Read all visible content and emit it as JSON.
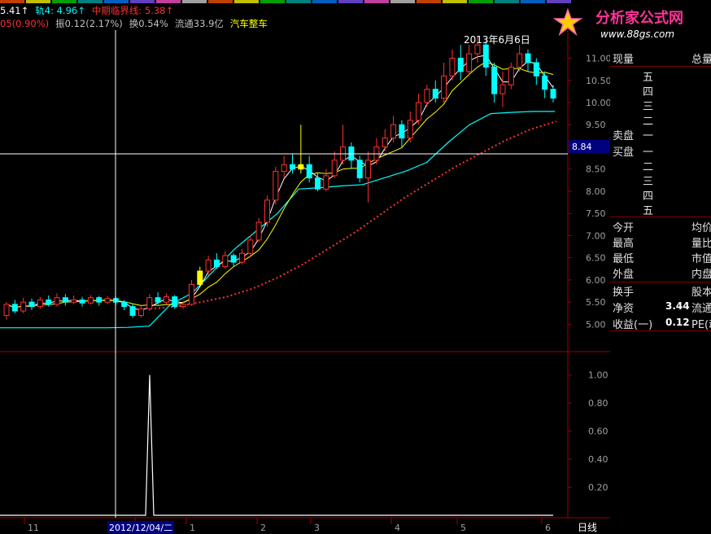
{
  "legend": {
    "line1": [
      {
        "text": "5.41↑",
        "color": "#ffffff"
      },
      {
        "text": "轨4: 4.96↑",
        "color": "#00ffff"
      },
      {
        "text": "中期临界线: 5.38↑",
        "color": "#ff3030"
      }
    ],
    "line2": [
      {
        "text": "05(0.90%)",
        "color": "#ff3030"
      },
      {
        "text": "振0.12(2.17%)",
        "color": "#c0c0c0"
      },
      {
        "text": "换0.54%",
        "color": "#c0c0c0"
      },
      {
        "text": "流通33.9亿",
        "color": "#c0c0c0"
      },
      {
        "text": "汽车整车",
        "color": "#ffff00"
      }
    ]
  },
  "logo": {
    "title": "分析家公式网",
    "url": "www.88gs.com"
  },
  "main_panel": {
    "annotation": "2013年6月6日",
    "crosshair_price": "8.84",
    "y_ticks": [
      "11.00",
      "10.50",
      "10.00",
      "9.50",
      "9.00",
      "8.50",
      "8.00",
      "7.50",
      "7.00",
      "6.50",
      "6.00",
      "5.50",
      "5.00"
    ]
  },
  "sub_panel": {
    "y_ticks": [
      "1.00",
      "0.80",
      "0.60",
      "0.40",
      "0.20"
    ]
  },
  "x_axis": {
    "labels": [
      "11",
      "2012/12/04/二",
      "1",
      "2",
      "3",
      "4",
      "5",
      "6"
    ],
    "period": "日线"
  },
  "side_panel": {
    "header": {
      "left": "现量",
      "right": "总量"
    },
    "asks": [
      "五",
      "四",
      "三",
      "二",
      "一"
    ],
    "sell_label": "卖盘",
    "buy_label": "买盘",
    "bids": [
      "一",
      "二",
      "三",
      "四",
      "五"
    ],
    "stats_left": [
      "今开",
      "最高",
      "最低",
      "外盘"
    ],
    "stats_right": [
      "均价",
      "量比",
      "市值",
      "内盘"
    ],
    "turnover_label": "换手",
    "turnover_right": "股本",
    "nav_label": "净资",
    "nav_value": "3.44",
    "nav_right": "流通",
    "eps_label": "收益(一)",
    "eps_value": "0.12",
    "eps_right": "PE(动"
  },
  "chart_data": {
    "type": "candlestick",
    "ylim": [
      4.75,
      11.45
    ],
    "series": [
      {
        "name": "轨4",
        "color": "#00ffff",
        "values": [
          4.92,
          4.92,
          4.92,
          4.92,
          4.92,
          4.92,
          4.93,
          4.96,
          5.45,
          5.7,
          6.2,
          6.7,
          7.1,
          7.5,
          8.05,
          8.08,
          8.12,
          8.15,
          8.3,
          8.45,
          8.65,
          9.1,
          9.5,
          9.75,
          9.78,
          9.8,
          9.8
        ]
      },
      {
        "name": "中期临界线",
        "color": "#ff3030",
        "values": [
          5.35,
          5.4,
          5.5,
          5.62,
          5.8,
          6.05,
          6.35,
          6.7,
          7.05,
          7.45,
          7.85,
          8.2,
          8.55,
          8.85,
          9.15,
          9.4,
          9.58
        ]
      }
    ],
    "candles": [
      {
        "o": 5.2,
        "c": 5.45,
        "h": 5.5,
        "l": 5.1
      },
      {
        "o": 5.45,
        "c": 5.3,
        "h": 5.55,
        "l": 5.25
      },
      {
        "o": 5.3,
        "c": 5.5,
        "h": 5.6,
        "l": 5.25
      },
      {
        "o": 5.5,
        "c": 5.4,
        "h": 5.58,
        "l": 5.32
      },
      {
        "o": 5.4,
        "c": 5.55,
        "h": 5.62,
        "l": 5.35
      },
      {
        "o": 5.55,
        "c": 5.45,
        "h": 5.65,
        "l": 5.4
      },
      {
        "o": 5.45,
        "c": 5.6,
        "h": 5.7,
        "l": 5.4
      },
      {
        "o": 5.6,
        "c": 5.5,
        "h": 5.68,
        "l": 5.42
      },
      {
        "o": 5.5,
        "c": 5.55,
        "h": 5.65,
        "l": 5.45
      },
      {
        "o": 5.55,
        "c": 5.48,
        "h": 5.62,
        "l": 5.4
      },
      {
        "o": 5.48,
        "c": 5.6,
        "h": 5.66,
        "l": 5.44
      },
      {
        "o": 5.6,
        "c": 5.5,
        "h": 5.64,
        "l": 5.42
      },
      {
        "o": 5.5,
        "c": 5.58,
        "h": 5.63,
        "l": 5.46
      },
      {
        "o": 5.58,
        "c": 5.5,
        "h": 5.62,
        "l": 5.44
      },
      {
        "o": 5.5,
        "c": 5.4,
        "h": 5.55,
        "l": 5.32
      },
      {
        "o": 5.4,
        "c": 5.2,
        "h": 5.45,
        "l": 5.15
      },
      {
        "o": 5.2,
        "c": 5.35,
        "h": 5.4,
        "l": 5.15
      },
      {
        "o": 5.35,
        "c": 5.6,
        "h": 5.68,
        "l": 5.3
      },
      {
        "o": 5.6,
        "c": 5.5,
        "h": 5.72,
        "l": 5.45
      },
      {
        "o": 5.5,
        "c": 5.62,
        "h": 5.7,
        "l": 5.45
      },
      {
        "o": 5.62,
        "c": 5.4,
        "h": 5.66,
        "l": 5.35
      },
      {
        "o": 5.4,
        "c": 5.45,
        "h": 5.52,
        "l": 5.35
      },
      {
        "o": 5.45,
        "c": 5.9,
        "h": 6.0,
        "l": 5.42
      },
      {
        "o": 5.9,
        "c": 6.2,
        "h": 6.3,
        "l": 5.85
      },
      {
        "o": 6.2,
        "c": 6.45,
        "h": 6.55,
        "l": 6.1
      },
      {
        "o": 6.45,
        "c": 6.3,
        "h": 6.6,
        "l": 6.25
      },
      {
        "o": 6.3,
        "c": 6.55,
        "h": 6.65,
        "l": 6.25
      },
      {
        "o": 6.55,
        "c": 6.4,
        "h": 6.6,
        "l": 6.3
      },
      {
        "o": 6.4,
        "c": 6.6,
        "h": 6.7,
        "l": 6.35
      },
      {
        "o": 6.6,
        "c": 6.9,
        "h": 7.0,
        "l": 6.5
      },
      {
        "o": 6.9,
        "c": 7.3,
        "h": 7.4,
        "l": 6.85
      },
      {
        "o": 7.3,
        "c": 7.8,
        "h": 7.9,
        "l": 7.2
      },
      {
        "o": 7.8,
        "c": 8.45,
        "h": 8.55,
        "l": 7.7
      },
      {
        "o": 8.45,
        "c": 8.6,
        "h": 8.8,
        "l": 8.3
      },
      {
        "o": 8.6,
        "c": 8.5,
        "h": 8.85,
        "l": 8.4
      },
      {
        "o": 8.5,
        "c": 8.6,
        "h": 9.5,
        "l": 8.4
      },
      {
        "o": 8.6,
        "c": 8.3,
        "h": 8.8,
        "l": 8.2
      },
      {
        "o": 8.3,
        "c": 8.05,
        "h": 8.4,
        "l": 8.0
      },
      {
        "o": 8.05,
        "c": 8.35,
        "h": 8.5,
        "l": 8.0
      },
      {
        "o": 8.35,
        "c": 8.7,
        "h": 8.9,
        "l": 8.3
      },
      {
        "o": 8.7,
        "c": 9.0,
        "h": 9.5,
        "l": 8.6
      },
      {
        "o": 9.0,
        "c": 8.7,
        "h": 9.1,
        "l": 8.5
      },
      {
        "o": 8.7,
        "c": 8.3,
        "h": 8.8,
        "l": 8.2
      },
      {
        "o": 8.3,
        "c": 8.7,
        "h": 8.9,
        "l": 7.75
      },
      {
        "o": 8.7,
        "c": 9.0,
        "h": 9.2,
        "l": 8.6
      },
      {
        "o": 9.0,
        "c": 9.2,
        "h": 9.4,
        "l": 8.9
      },
      {
        "o": 9.2,
        "c": 9.5,
        "h": 9.7,
        "l": 9.1
      },
      {
        "o": 9.5,
        "c": 9.2,
        "h": 9.6,
        "l": 9.0
      },
      {
        "o": 9.2,
        "c": 9.6,
        "h": 9.8,
        "l": 9.1
      },
      {
        "o": 9.6,
        "c": 10.0,
        "h": 10.2,
        "l": 9.5
      },
      {
        "o": 10.0,
        "c": 10.3,
        "h": 10.4,
        "l": 9.9
      },
      {
        "o": 10.3,
        "c": 10.1,
        "h": 10.5,
        "l": 10.0
      },
      {
        "o": 10.1,
        "c": 10.6,
        "h": 10.9,
        "l": 10.0
      },
      {
        "o": 10.6,
        "c": 11.0,
        "h": 11.2,
        "l": 10.5
      },
      {
        "o": 11.0,
        "c": 10.7,
        "h": 11.3,
        "l": 10.5
      },
      {
        "o": 10.7,
        "c": 11.1,
        "h": 11.3,
        "l": 10.6
      },
      {
        "o": 11.1,
        "c": 11.3,
        "h": 11.5,
        "l": 10.9
      },
      {
        "o": 11.3,
        "c": 10.8,
        "h": 11.4,
        "l": 10.6
      },
      {
        "o": 10.8,
        "c": 10.2,
        "h": 10.9,
        "l": 10.0
      },
      {
        "o": 10.2,
        "c": 10.4,
        "h": 10.7,
        "l": 9.9
      },
      {
        "o": 10.4,
        "c": 10.8,
        "h": 10.9,
        "l": 10.3
      },
      {
        "o": 10.8,
        "c": 11.1,
        "h": 11.3,
        "l": 10.7
      },
      {
        "o": 11.1,
        "c": 10.9,
        "h": 11.2,
        "l": 10.7
      },
      {
        "o": 10.9,
        "c": 10.6,
        "h": 11.0,
        "l": 10.4
      },
      {
        "o": 10.6,
        "c": 10.3,
        "h": 10.7,
        "l": 10.1
      },
      {
        "o": 10.3,
        "c": 10.1,
        "h": 10.4,
        "l": 10.0
      }
    ],
    "highlighted_candles": [
      23,
      35
    ],
    "indicator": {
      "values_at": {
        "spike_index": 23,
        "spike_value": 1.0
      },
      "ylim": [
        0,
        1.05
      ]
    }
  }
}
